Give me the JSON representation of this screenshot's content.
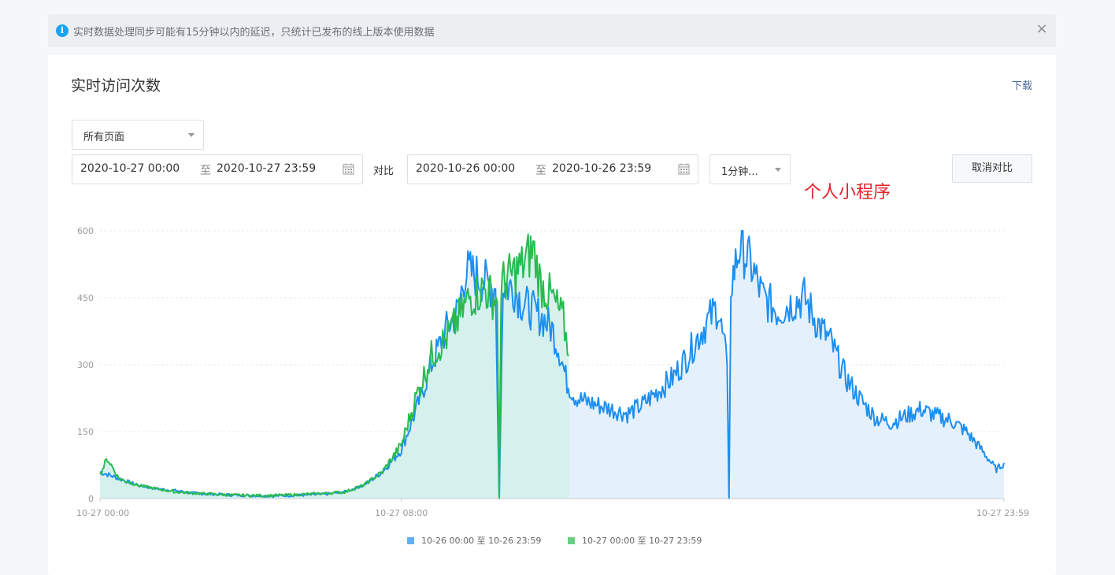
{
  "notice": {
    "icon": "info-icon",
    "text": "实时数据处理同步可能有15分钟以内的延迟，只统计已发布的线上版本使用数据",
    "close": "×"
  },
  "card": {
    "title": "实时访问次数",
    "download": "下载",
    "page_select": {
      "value": "所有页面"
    },
    "range1": {
      "start": "2020-10-27 00:00",
      "sep": "至",
      "end": "2020-10-27 23:59"
    },
    "compare_label": "对比",
    "range2": {
      "start": "2020-10-26 00:00",
      "sep": "至",
      "end": "2020-10-26 23:59"
    },
    "interval_select": {
      "value": "1分钟..."
    },
    "cancel_compare": "取消对比",
    "annotation": "个人小程序"
  },
  "chart_data": {
    "type": "area",
    "ylim": [
      0,
      600
    ],
    "yticks": [
      "0",
      "150",
      "300",
      "450",
      "600"
    ],
    "xticks": [
      "10-27 00:00",
      "10-27 08:00",
      "10-27 23:59"
    ],
    "x_range_hours": [
      0,
      24
    ],
    "colors": {
      "blue": "#1e8ff0",
      "green": "#29bb4f",
      "blue_fill": "#e4f1fc",
      "green_fill": "#d4efeb"
    },
    "series": [
      {
        "name": "10-26 00:00 至 10-26 23:59",
        "color": "#1e8ff0",
        "points": [
          [
            0,
            60
          ],
          [
            0.5,
            45
          ],
          [
            1,
            30
          ],
          [
            1.5,
            22
          ],
          [
            2,
            18
          ],
          [
            2.5,
            12
          ],
          [
            3,
            10
          ],
          [
            3.5,
            8
          ],
          [
            4,
            7
          ],
          [
            4.5,
            6
          ],
          [
            5,
            7
          ],
          [
            5.5,
            8
          ],
          [
            6,
            10
          ],
          [
            6.5,
            15
          ],
          [
            7,
            30
          ],
          [
            7.5,
            60
          ],
          [
            8,
            110
          ],
          [
            8.4,
            200
          ],
          [
            8.8,
            300
          ],
          [
            9.2,
            380
          ],
          [
            9.5,
            420
          ],
          [
            9.7,
            510
          ],
          [
            10,
            500
          ],
          [
            10.3,
            480
          ],
          [
            10.5,
            470
          ],
          [
            10.6,
            0
          ],
          [
            10.7,
            480
          ],
          [
            11,
            470
          ],
          [
            11.2,
            440
          ],
          [
            11.5,
            420
          ],
          [
            11.8,
            400
          ],
          [
            12,
            380
          ],
          [
            12.2,
            330
          ],
          [
            12.4,
            260
          ],
          [
            12.6,
            230
          ],
          [
            12.8,
            220
          ],
          [
            13.2,
            210
          ],
          [
            13.6,
            200
          ],
          [
            14,
            190
          ],
          [
            14.4,
            210
          ],
          [
            14.8,
            240
          ],
          [
            15.2,
            270
          ],
          [
            15.6,
            320
          ],
          [
            16,
            380
          ],
          [
            16.4,
            430
          ],
          [
            16.65,
            300
          ],
          [
            16.7,
            0
          ],
          [
            16.75,
            480
          ],
          [
            17,
            570
          ],
          [
            17.3,
            520
          ],
          [
            17.6,
            450
          ],
          [
            18,
            420
          ],
          [
            18.4,
            440
          ],
          [
            18.7,
            450
          ],
          [
            19,
            400
          ],
          [
            19.4,
            350
          ],
          [
            19.8,
            270
          ],
          [
            20.2,
            220
          ],
          [
            20.6,
            180
          ],
          [
            21,
            170
          ],
          [
            21.4,
            185
          ],
          [
            21.8,
            200
          ],
          [
            22.2,
            185
          ],
          [
            22.6,
            175
          ],
          [
            23,
            150
          ],
          [
            23.4,
            110
          ],
          [
            23.8,
            65
          ],
          [
            24,
            80
          ]
        ]
      },
      {
        "name": "10-27 00:00 至 10-27 23:59",
        "color": "#29bb4f",
        "points": [
          [
            0,
            55
          ],
          [
            0.2,
            90
          ],
          [
            0.5,
            45
          ],
          [
            1,
            30
          ],
          [
            1.5,
            22
          ],
          [
            2,
            15
          ],
          [
            2.5,
            12
          ],
          [
            3,
            10
          ],
          [
            3.5,
            8
          ],
          [
            4,
            7
          ],
          [
            4.5,
            7
          ],
          [
            5,
            8
          ],
          [
            5.5,
            10
          ],
          [
            6,
            12
          ],
          [
            6.5,
            15
          ],
          [
            7,
            30
          ],
          [
            7.5,
            60
          ],
          [
            8,
            120
          ],
          [
            8.4,
            230
          ],
          [
            8.8,
            320
          ],
          [
            9.2,
            360
          ],
          [
            9.5,
            400
          ],
          [
            9.8,
            450
          ],
          [
            10.2,
            470
          ],
          [
            10.55,
            440
          ],
          [
            10.6,
            0
          ],
          [
            10.65,
            480
          ],
          [
            10.9,
            500
          ],
          [
            11.2,
            520
          ],
          [
            11.5,
            560
          ],
          [
            11.7,
            480
          ],
          [
            12,
            450
          ],
          [
            12.3,
            400
          ],
          [
            12.45,
            320
          ]
        ]
      }
    ]
  }
}
